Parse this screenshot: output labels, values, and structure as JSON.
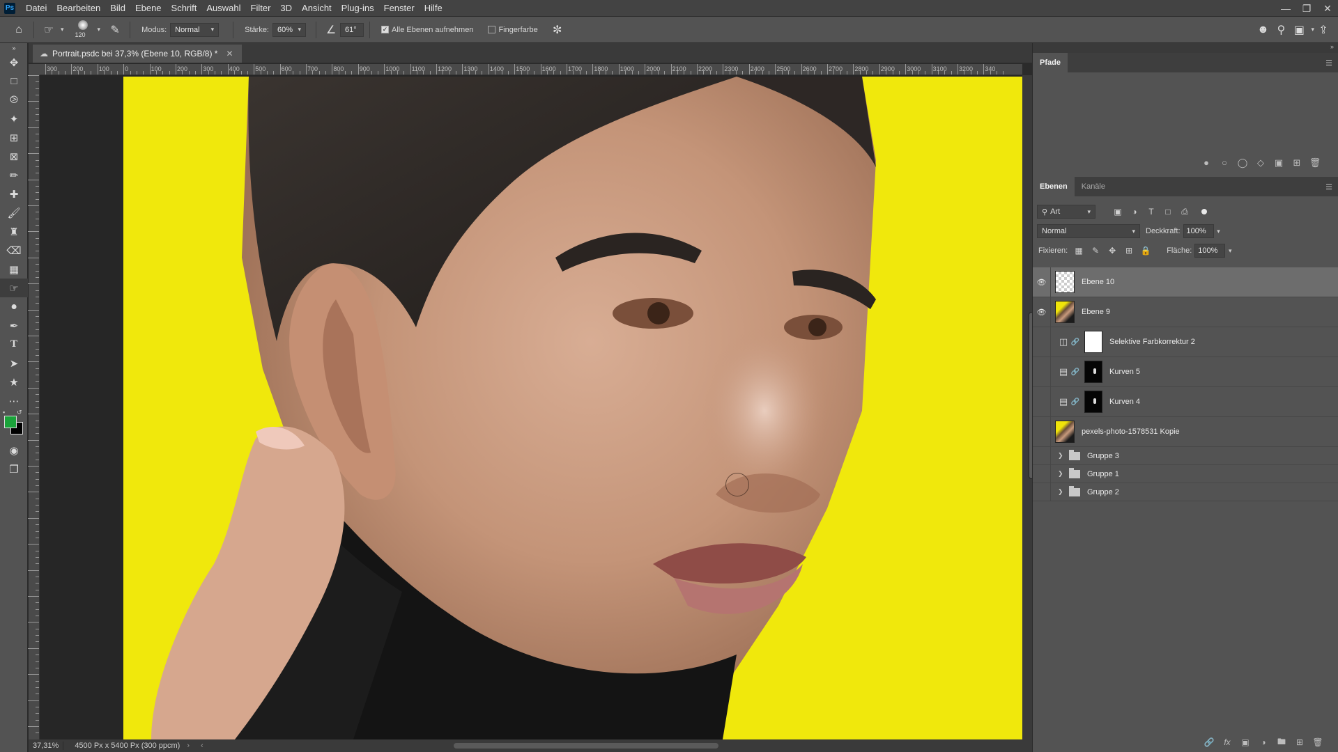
{
  "menu": {
    "items": [
      "Datei",
      "Bearbeiten",
      "Bild",
      "Ebene",
      "Schrift",
      "Auswahl",
      "Filter",
      "3D",
      "Ansicht",
      "Plug-ins",
      "Fenster",
      "Hilfe"
    ]
  },
  "options": {
    "brush_size": "120",
    "mode_label": "Modus:",
    "mode_value": "Normal",
    "strength_label": "Stärke:",
    "strength_value": "60%",
    "angle_value": "61°",
    "sample_all_label": "Alle Ebenen aufnehmen",
    "finger_paint_label": "Fingerfarbe"
  },
  "document": {
    "tab_title": "Portrait.psdc bei 37,3% (Ebene 10, RGB/8) *",
    "zoom": "37,31%",
    "doc_info": "4500 Px x 5400 Px (300 ppcm)"
  },
  "ruler": {
    "labels": [
      "300",
      "200",
      "100",
      "0",
      "100",
      "200",
      "300",
      "400",
      "500",
      "600",
      "700",
      "800",
      "900",
      "1000",
      "1100",
      "1200",
      "1300",
      "1400",
      "1500",
      "1600",
      "1700",
      "1800",
      "1900",
      "2000",
      "2100",
      "2200",
      "2300",
      "2400",
      "2500",
      "2600",
      "2700",
      "2800",
      "2900",
      "3000",
      "3100",
      "3200",
      "340"
    ]
  },
  "paths_panel": {
    "title": "Pfade"
  },
  "layers_panel": {
    "tabs": [
      "Ebenen",
      "Kanäle"
    ],
    "filter_kind": "Art",
    "blend_mode": "Normal",
    "opacity_label": "Deckkraft:",
    "opacity_value": "100%",
    "lock_label": "Fixieren:",
    "fill_label": "Fläche:",
    "fill_value": "100%",
    "layers": [
      {
        "name": "Ebene 10",
        "visible": true,
        "selected": true,
        "kind": "transparent"
      },
      {
        "name": "Ebene 9",
        "visible": true,
        "selected": false,
        "kind": "photo"
      },
      {
        "name": "Selektive Farbkorrektur 2",
        "visible": false,
        "selected": false,
        "kind": "adjustment-white"
      },
      {
        "name": "Kurven 5",
        "visible": false,
        "selected": false,
        "kind": "adjustment-black"
      },
      {
        "name": "Kurven 4",
        "visible": false,
        "selected": false,
        "kind": "adjustment-black"
      },
      {
        "name": "pexels-photo-1578531 Kopie",
        "visible": false,
        "selected": false,
        "kind": "photo"
      },
      {
        "name": "Gruppe 3",
        "visible": false,
        "selected": false,
        "kind": "group"
      },
      {
        "name": "Gruppe 1",
        "visible": false,
        "selected": false,
        "kind": "group"
      },
      {
        "name": "Gruppe 2",
        "visible": false,
        "selected": false,
        "kind": "group"
      }
    ]
  },
  "colors": {
    "foreground": "#1aa33a",
    "background": "#000000",
    "canvas_background": "#f0e80c"
  }
}
